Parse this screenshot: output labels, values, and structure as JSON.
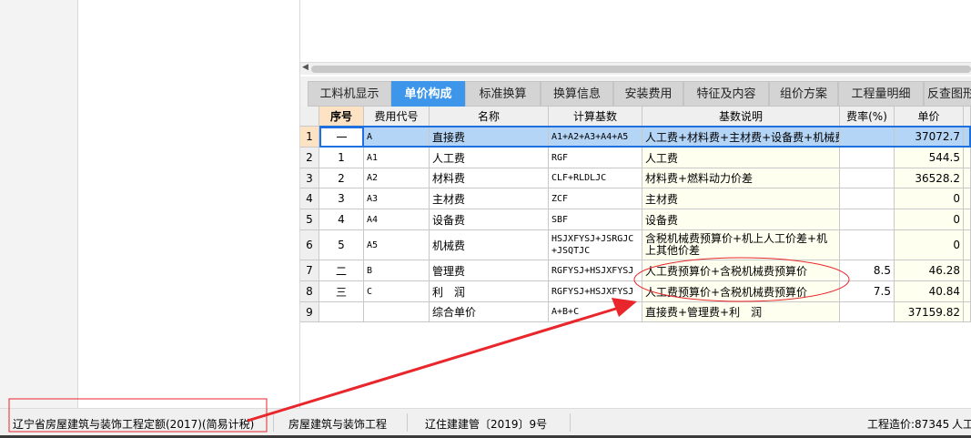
{
  "tabs": [
    "工料机显示",
    "单价构成",
    "标准换算",
    "换算信息",
    "安装费用",
    "特征及内容",
    "组价方案",
    "工程量明细",
    "反查图形"
  ],
  "active_tab": 1,
  "columns": [
    "序号",
    "费用代号",
    "名称",
    "计算基数",
    "基数说明",
    "费率(%)",
    "单价"
  ],
  "rows": [
    {
      "n": "1",
      "seq": "一",
      "code": "A",
      "name": "直接费",
      "base": "A1+A2+A3+A4+A5",
      "desc": "人工费+材料费+主材费+设备费+机械费",
      "rate": "",
      "price": "37072.7"
    },
    {
      "n": "2",
      "seq": "1",
      "code": "A1",
      "name": "人工费",
      "base": "RGF",
      "desc": "人工费",
      "rate": "",
      "price": "544.5"
    },
    {
      "n": "3",
      "seq": "2",
      "code": "A2",
      "name": "材料费",
      "base": "CLF+RLDLJC",
      "desc": "材料费+燃料动力价差",
      "rate": "",
      "price": "36528.2"
    },
    {
      "n": "4",
      "seq": "3",
      "code": "A3",
      "name": "主材费",
      "base": "ZCF",
      "desc": "主材费",
      "rate": "",
      "price": "0"
    },
    {
      "n": "5",
      "seq": "4",
      "code": "A4",
      "name": "设备费",
      "base": "SBF",
      "desc": "设备费",
      "rate": "",
      "price": "0"
    },
    {
      "n": "6",
      "seq": "5",
      "code": "A5",
      "name": "机械费",
      "base": "HSJXFYSJ+JSRGJC +JSQTJC",
      "desc": "含税机械费预算价+机上人工价差+机上其他价差",
      "rate": "",
      "price": "0"
    },
    {
      "n": "7",
      "seq": "二",
      "code": "B",
      "name": "管理费",
      "base": "RGFYSJ+HSJXFYSJ",
      "desc": "人工费预算价+含税机械费预算价",
      "rate": "8.5",
      "price": "46.28"
    },
    {
      "n": "8",
      "seq": "三",
      "code": "C",
      "name": "利　润",
      "base": "RGFYSJ+HSJXFYSJ",
      "desc": "人工费预算价+含税机械费预算价",
      "rate": "7.5",
      "price": "40.84"
    },
    {
      "n": "9",
      "seq": "",
      "code": "",
      "name": "综合单价",
      "base": "A+B+C",
      "desc": "直接费+管理费+利　润",
      "rate": "",
      "price": "37159.82"
    }
  ],
  "status": {
    "quota": "辽宁省房屋建筑与装饰工程定额(2017)(简易计税)",
    "specialty": "房屋建筑与装饰工程",
    "document": "辽住建建管〔2019〕9号",
    "cost": "工程造价:87345",
    "extra": "人工"
  },
  "colors": {
    "accent": "#3e96ea",
    "annotation": "#e8262b",
    "selected_row": "#b5d5f7"
  }
}
